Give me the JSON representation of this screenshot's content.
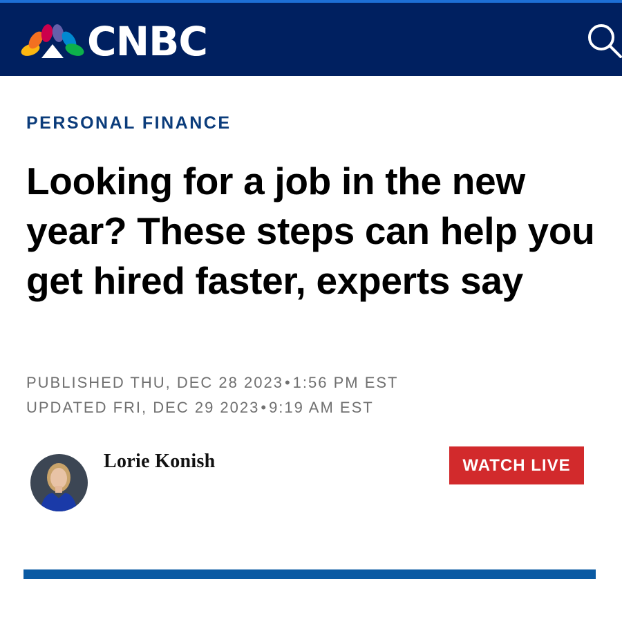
{
  "header": {
    "brand": "CNBC",
    "logo_icon": "nbc-peacock-icon",
    "search_icon": "search-icon",
    "background_color": "#002060",
    "accent_strip_color": "#1d6fd6"
  },
  "article": {
    "section": "PERSONAL FINANCE",
    "headline": "Looking for a job in the new year? These steps can help you get hired faster, experts say",
    "published": {
      "prefix": "PUBLISHED THU, DEC 28 2023",
      "time": "1:56 PM EST"
    },
    "updated": {
      "prefix": "UPDATED FRI, DEC 29 2023",
      "time": "9:19 AM EST"
    },
    "author": {
      "name": "Lorie Konish",
      "avatar_icon": "author-avatar"
    }
  },
  "actions": {
    "watch_live": "WATCH LIVE",
    "watch_live_color": "#d22a2c"
  },
  "colors": {
    "section_label": "#0b3c7b",
    "divider": "#0a5aa3"
  }
}
